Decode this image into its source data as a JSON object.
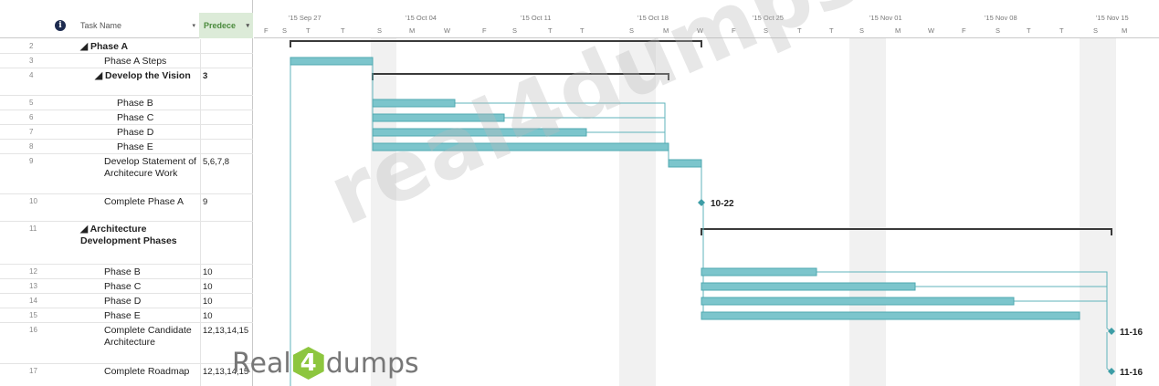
{
  "header": {
    "info_glyph": "i",
    "task_name": "Task Name",
    "predecessors": "Predece",
    "caret": "▾"
  },
  "timeline": {
    "weeks": [
      "'15 Sep 27",
      "'15 Oct 04",
      "'15 Oct 11",
      "'15 Oct 18",
      "'15 Oct 25",
      "'15 Nov 01",
      "'15 Nov 08",
      "'15 Nov 15"
    ],
    "days": [
      "F",
      "S",
      "T",
      "T",
      "S",
      "M",
      "W",
      "F",
      "S",
      "T",
      "T",
      "S",
      "M",
      "W",
      "F",
      "S",
      "T",
      "T",
      "S",
      "M",
      "W",
      "F",
      "S",
      "T",
      "T",
      "S",
      "M"
    ]
  },
  "tasks": [
    {
      "id": "2",
      "name": "◢ Phase A",
      "pred": "",
      "bold": true
    },
    {
      "id": "3",
      "name": "Phase A Steps",
      "pred": "",
      "bold": false
    },
    {
      "id": "4",
      "name": "◢ Develop the Vision",
      "pred": "3",
      "bold": true
    },
    {
      "id": "5",
      "name": "Phase B",
      "pred": "",
      "bold": false
    },
    {
      "id": "6",
      "name": "Phase C",
      "pred": "",
      "bold": false
    },
    {
      "id": "7",
      "name": "Phase D",
      "pred": "",
      "bold": false
    },
    {
      "id": "8",
      "name": "Phase E",
      "pred": "",
      "bold": false
    },
    {
      "id": "9",
      "name": "Develop Statement of Architecure Work",
      "pred": "5,6,7,8",
      "bold": false
    },
    {
      "id": "10",
      "name": "Complete Phase A",
      "pred": "9",
      "bold": false
    },
    {
      "id": "11",
      "name": "◢ Architecture Development Phases",
      "pred": "",
      "bold": true
    },
    {
      "id": "12",
      "name": "Phase B",
      "pred": "10",
      "bold": false
    },
    {
      "id": "13",
      "name": "Phase C",
      "pred": "10",
      "bold": false
    },
    {
      "id": "14",
      "name": "Phase D",
      "pred": "10",
      "bold": false
    },
    {
      "id": "15",
      "name": "Phase E",
      "pred": "10",
      "bold": false
    },
    {
      "id": "16",
      "name": "Complete Candidate Architecture",
      "pred": "12,13,14,15",
      "bold": false
    },
    {
      "id": "17",
      "name": "Complete Roadmap",
      "pred": "12,13,14,15",
      "bold": false
    }
  ],
  "milestones": {
    "complete_phase_a": "10-22",
    "complete_candidate": "11-16",
    "complete_roadmap": "11-16"
  },
  "colors": {
    "bar": "#7cc5cc",
    "bar_edge": "#4fa9b1",
    "summary": "#3a3a3a",
    "link": "#5fb3bb",
    "milestone": "#3d9da6"
  },
  "watermark": {
    "big": "real4dumps.com",
    "logo_left": "Real",
    "logo_mid": "4",
    "logo_right": "dumps"
  }
}
